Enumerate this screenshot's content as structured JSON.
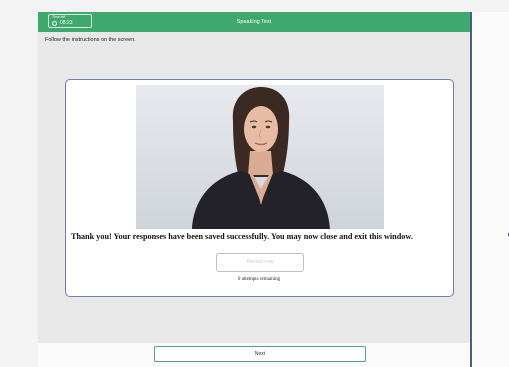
{
  "header": {
    "timer_label": "Time left",
    "timer_value": "08:23",
    "title": "Speaking Test"
  },
  "instructions": "Follow the instructions on the screen.",
  "panel": {
    "message": "Thank you! Your responses have been saved successfully. You may now close and exit this window.",
    "record_button_label": "Record now",
    "attempts_text": "0 attempts remaining"
  },
  "footer": {
    "next_label": "Next"
  },
  "colors": {
    "header_green": "#3fa86d",
    "panel_border": "#6b7fb3",
    "divider_blue": "#4a5e8a"
  }
}
